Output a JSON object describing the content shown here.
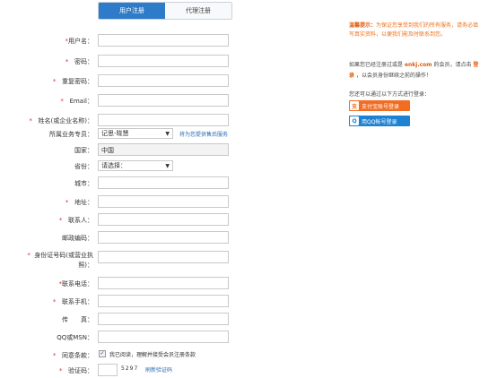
{
  "tabs": {
    "personal": "用户注册",
    "agent": "代理注册"
  },
  "fields": {
    "username": {
      "label": "*用户名：",
      "value": ""
    },
    "password": {
      "label": "*　密码：",
      "value": ""
    },
    "repeat_password": {
      "label": "*　重复密码：",
      "value": ""
    },
    "email": {
      "label": "*　Email：",
      "value": ""
    },
    "name": {
      "label": "*　姓名(或企业名称)：",
      "value": ""
    },
    "salesman": {
      "label": "所属业务专员：",
      "value": "记思-晓慧",
      "hint": "将为您提供售后服务"
    },
    "country": {
      "label": "国家：",
      "value": "中国"
    },
    "province": {
      "label": "省份：",
      "value": "请选择："
    },
    "city": {
      "label": "城市：",
      "value": ""
    },
    "address": {
      "label": "*　地址：",
      "value": ""
    },
    "contact": {
      "label": "*　联系人：",
      "value": ""
    },
    "zip": {
      "label": "邮政编码：",
      "value": ""
    },
    "id_number": {
      "label": "*　身份证号码(或营业执",
      "label2": "照)：",
      "value": ""
    },
    "phone": {
      "label": "*联系电话：",
      "value": ""
    },
    "mobile": {
      "label": "*　联系手机：",
      "value": ""
    },
    "fax": {
      "label": "传　　真：",
      "value": ""
    },
    "qq": {
      "label": "QQ或MSN：",
      "value": ""
    },
    "agree": {
      "label": "*　同意条款：",
      "text": "我已阅读，理解并接受会员注册条款",
      "checked": true
    },
    "captcha": {
      "label": "*　验证码：",
      "code": "5297",
      "refresh": "刷新验证码"
    }
  },
  "side": {
    "notice_title": "温馨提示：",
    "notice_text": "为保证您享受到我们的所有服务，请务必填写真实资料，以便我们能及时联系到您。",
    "login_pre": "如果您已经注册过或是",
    "site": "enkj.com",
    "login_mid": "的会员，请点击",
    "login_link": "登录",
    "login_post": "，以会员身份继续之前的操作！",
    "other_title": "您还可以通过以下方式进行登录：",
    "alipay": "支付宝账号登录",
    "qq": "用QQ帐号登录"
  }
}
